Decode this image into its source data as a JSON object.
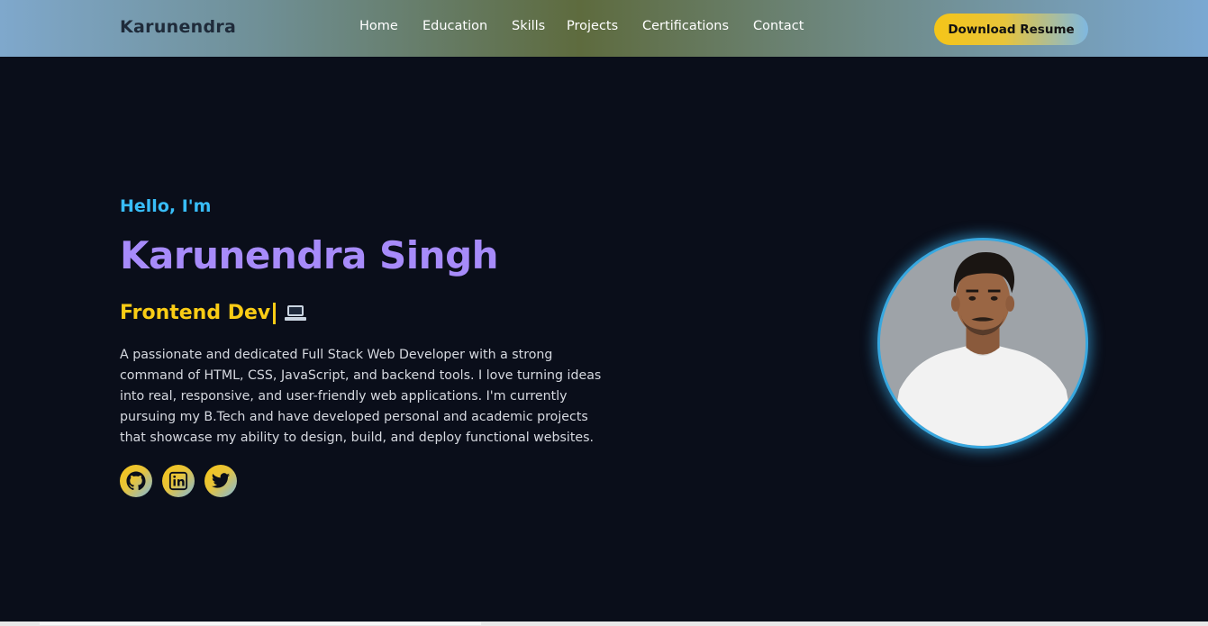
{
  "navbar": {
    "brand": "Karunendra",
    "links": [
      {
        "label": "Home"
      },
      {
        "label": "Education"
      },
      {
        "label": "Skills"
      },
      {
        "label": "Projects"
      },
      {
        "label": "Certifications"
      },
      {
        "label": "Contact"
      }
    ],
    "resume_button": "Download Resume"
  },
  "hero": {
    "greeting": "Hello, I'm",
    "name": "Karunendra Singh",
    "role": "Frontend Dev",
    "role_icon": "laptop-icon",
    "bio": "A passionate and dedicated Full Stack Web Developer with a strong command of HTML, CSS, JavaScript, and backend tools. I love turning ideas into real, responsive, and user-friendly web applications. I'm currently pursuing my B.Tech and have developed personal and academic projects that showcase my ability to design, build, and deploy functional websites.",
    "socials": [
      {
        "icon": "github-icon"
      },
      {
        "icon": "linkedin-icon"
      },
      {
        "icon": "twitter-icon"
      }
    ]
  },
  "colors": {
    "background": "#0a0e1a",
    "greeting": "#38bdf8",
    "name": "#a78bfa",
    "role": "#facc15",
    "avatar_border": "#38a8e0"
  }
}
